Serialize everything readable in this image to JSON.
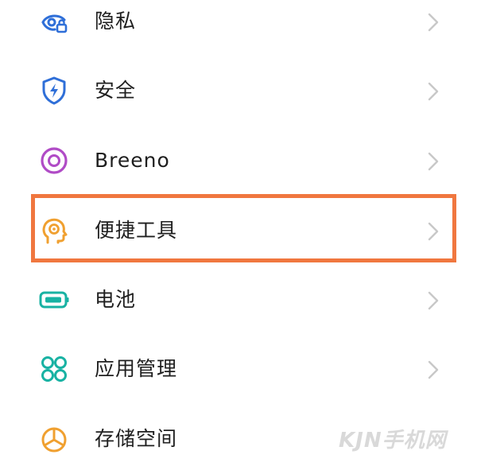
{
  "settings": {
    "items": [
      {
        "label": "隐私",
        "icon": "privacy-eye-lock-icon"
      },
      {
        "label": "安全",
        "icon": "shield-bolt-icon"
      },
      {
        "label": "Breeno",
        "icon": "breeno-ring-icon"
      },
      {
        "label": "便捷工具",
        "icon": "head-profile-icon"
      },
      {
        "label": "电池",
        "icon": "battery-icon"
      },
      {
        "label": "应用管理",
        "icon": "app-grid-icon"
      },
      {
        "label": "存储空间",
        "icon": "storage-pie-icon"
      }
    ],
    "highlighted_item": "便捷工具"
  },
  "colors": {
    "accent_blue": "#2f6fd8",
    "accent_teal": "#18b2a3",
    "accent_purple": "#b04bc6",
    "accent_orange": "#f0a030",
    "highlight_border": "#f0773f",
    "chevron": "#c8c8c8",
    "text": "#1f1f1f"
  },
  "watermark": {
    "text": "KJN手机网"
  }
}
